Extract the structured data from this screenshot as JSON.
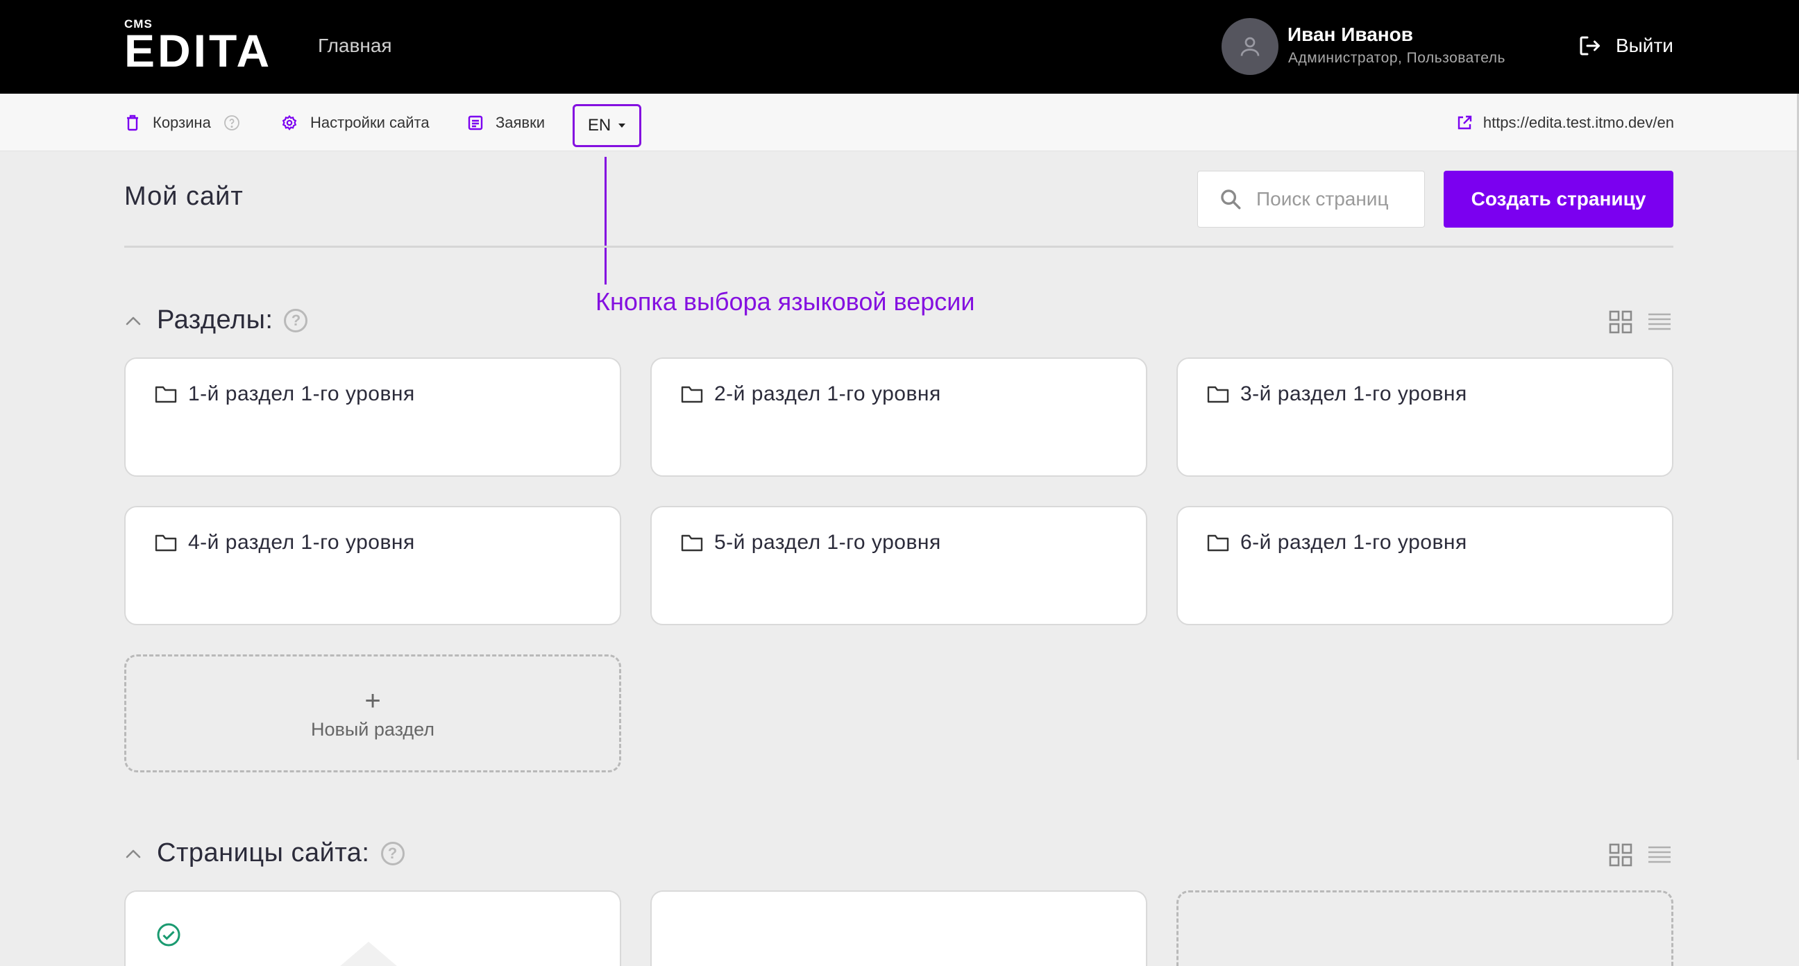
{
  "header": {
    "logo_small": "CMS",
    "logo_big": "EDITA",
    "nav_home": "Главная",
    "user_name": "Иван Иванов",
    "user_role": "Администратор, Пользователь",
    "logout_label": "Выйти"
  },
  "toolbar": {
    "trash_label": "Корзина",
    "settings_label": "Настройки сайта",
    "orders_label": "Заявки",
    "lang_label": "EN",
    "site_url": "https://edita.test.itmo.dev/en"
  },
  "annotation": {
    "text": "Кнопка выбора языковой версии"
  },
  "page": {
    "title": "Мой сайт",
    "search_placeholder": "Поиск страниц",
    "create_button": "Создать страницу"
  },
  "sections": {
    "title": "Разделы:",
    "help": "?",
    "items": [
      {
        "label": "1-й раздел 1-го уровня"
      },
      {
        "label": "2-й раздел 1-го уровня"
      },
      {
        "label": "3-й раздел 1-го уровня"
      },
      {
        "label": "4-й раздел 1-го уровня"
      },
      {
        "label": "5-й раздел 1-го уровня"
      },
      {
        "label": "6-й раздел 1-го уровня"
      }
    ],
    "new_plus": "+",
    "new_label": "Новый раздел"
  },
  "pages": {
    "title": "Страницы сайта:",
    "help": "?"
  },
  "colors": {
    "accent": "#7b00f0",
    "annotation": "#8410e0",
    "header_bg": "#000000",
    "page_bg": "#ededed",
    "success": "#1a9a70"
  },
  "icons": {
    "trash": "trash-icon",
    "settings": "gear-icon",
    "orders": "document-icon",
    "external": "external-link-icon",
    "logout": "logout-icon",
    "search": "search-icon",
    "folder": "folder-icon",
    "grid": "grid-view-icon",
    "list": "list-view-icon",
    "check": "check-circle-icon"
  }
}
